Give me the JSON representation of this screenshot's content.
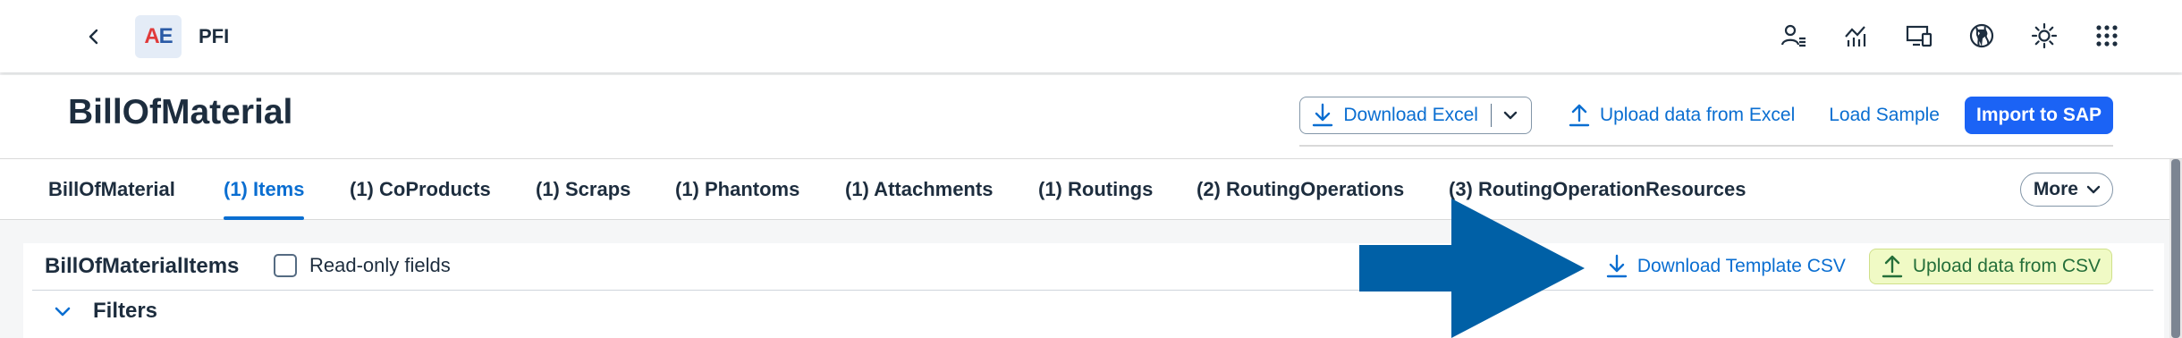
{
  "shell": {
    "back_icon": "chevron-left-icon",
    "logo_text_a": "A",
    "logo_text_e": "E",
    "app_title": "PFI",
    "icons": [
      "user-list-icon",
      "activity-chart-icon",
      "devices-icon",
      "globe-icon",
      "theme-brightness-icon",
      "app-grid-icon"
    ]
  },
  "header": {
    "title": "BillOfMaterial",
    "download_excel": "Download Excel",
    "upload_excel": "Upload data from Excel",
    "load_sample": "Load Sample",
    "import_sap": "Import to SAP"
  },
  "tabs": [
    {
      "label": "BillOfMaterial",
      "active": false
    },
    {
      "label": "(1) Items",
      "active": true
    },
    {
      "label": "(1) CoProducts",
      "active": false
    },
    {
      "label": "(1) Scraps",
      "active": false
    },
    {
      "label": "(1) Phantoms",
      "active": false
    },
    {
      "label": "(1) Attachments",
      "active": false
    },
    {
      "label": "(1) Routings",
      "active": false
    },
    {
      "label": "(2) RoutingOperations",
      "active": false
    },
    {
      "label": "(3) RoutingOperationResources",
      "active": false
    }
  ],
  "more_label": "More",
  "panel": {
    "title": "BillOfMaterialItems",
    "readonly_label": "Read-only fields",
    "readonly_checked": false,
    "download_csv": "Download Template CSV",
    "upload_csv": "Upload data from CSV",
    "filters_label": "Filters"
  },
  "colors": {
    "accent": "#0a6ed1",
    "emphasized": "#1b63f5",
    "arrow": "#0060a6",
    "upload_csv_bg": "#f0fac5"
  }
}
